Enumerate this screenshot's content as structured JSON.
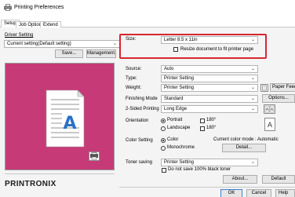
{
  "window": {
    "title": "Printing Preferences"
  },
  "tabs": [
    {
      "label": "Setup"
    },
    {
      "label": "Job Options"
    },
    {
      "label": "Extend"
    }
  ],
  "driver_setting": {
    "label": "Driver Setting",
    "value": "Current setting(Default setting)",
    "save_label": "Save...",
    "management_label": "Management..."
  },
  "brand": {
    "logo_text": "PRINTRONIX"
  },
  "form": {
    "size": {
      "label": "Size:",
      "value": "Letter 8.5 x 11in"
    },
    "resize": {
      "label": "Resize document to fit printer page",
      "checked": false
    },
    "source": {
      "label": "Source:",
      "value": "Auto"
    },
    "type": {
      "label": "Type:",
      "value": "Printer Setting"
    },
    "weight": {
      "label": "Weight:",
      "value": "Printer Setting"
    },
    "paper_feed_options_label": "Paper Feed Options...",
    "finishing_mode": {
      "label": "Finishing Mode",
      "value": "Standard"
    },
    "options_label": "Options...",
    "two_sided": {
      "label": "2-Sided Printing",
      "value": "Long Edge"
    },
    "orientation": {
      "label": "Orientation",
      "portrait_label": "Portrait",
      "landscape_label": "Landscape",
      "rotate180_label": "180°",
      "rotate180b_label": "180°",
      "selected": "Portrait"
    },
    "color_setting": {
      "label": "Color Setting",
      "color_label": "Color",
      "monochrome_label": "Monochrome",
      "selected": "Color",
      "current_mode_text": "Current color mode : Automatic",
      "detail_label": "Detail..."
    },
    "toner_saving": {
      "label": "Toner saving",
      "value": "Printer Setting",
      "no_black_label": "Do not save 100% black toner"
    }
  },
  "footer": {
    "about_label": "About...",
    "default_label": "Default",
    "ok_label": "OK",
    "cancel_label": "Cancel",
    "help_label": "Help"
  },
  "colors": {
    "highlight": "#d8262f",
    "preview_bg": "#c73a78",
    "page_icon_accent": "#2a6fc7"
  }
}
